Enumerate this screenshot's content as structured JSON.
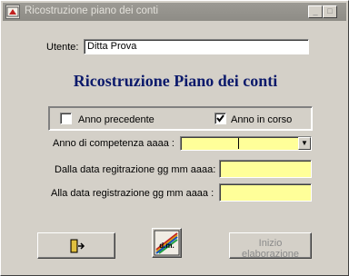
{
  "window": {
    "title": "Ricostruzione piano dei conti",
    "minimize_label": "_",
    "maximize_label": "□"
  },
  "user": {
    "label": "Utente:",
    "value": "Ditta Prova"
  },
  "heading": "Ricostruzione Piano dei conti",
  "options": {
    "previous_year": {
      "label": "Anno precedente",
      "checked": false
    },
    "current_year": {
      "label": "Anno in corso",
      "checked": true
    }
  },
  "competence_year": {
    "label": "Anno di competenza aaaa :",
    "value": ""
  },
  "date_from": {
    "label": "Dalla data regitrazione gg mm aaaa:",
    "value": ""
  },
  "date_to": {
    "label": "Alla  data registrazione gg mm aaaa :",
    "value": ""
  },
  "buttons": {
    "exit_icon": "exit-door-icon",
    "logo_text": "d.m.",
    "start_label_line1": "Inizio",
    "start_label_line2": "elaborazione"
  },
  "colors": {
    "heading": "#0c1a6b",
    "input_highlight": "#ffff99",
    "titlebar": "#9c9a94"
  }
}
